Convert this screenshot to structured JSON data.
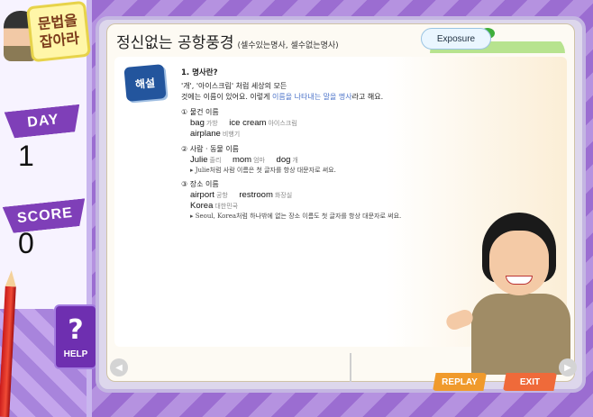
{
  "sidebar": {
    "logo_line1": "문법을",
    "logo_line2": "잡아라",
    "day_label": "DAY",
    "day_value": "1",
    "score_label": "SCORE",
    "score_value": "0",
    "help_label": "HELP"
  },
  "header": {
    "title": "정신없는 공항풍경",
    "subtitle": "(셀수있는명사, 셀수없는명사)",
    "exposure_label": "Exposure"
  },
  "lesson": {
    "badge": "해설",
    "heading": "1. 명사란?",
    "intro_a": "'개', '아이스크림' 처럼 세상의 모든",
    "intro_b": "것에는 이름이 있어요. 이렇게 ",
    "intro_highlight": "이름을 나타내는 말을 명사",
    "intro_c": "라고 해요.",
    "sections": [
      {
        "label": "① 물건 이름",
        "words": [
          {
            "en": "bag",
            "ko": "가방"
          },
          {
            "en": "ice cream",
            "ko": "아이스크림"
          },
          {
            "en": "airplane",
            "ko": "비행기"
          }
        ],
        "note": ""
      },
      {
        "label": "② 사람 · 동물 이름",
        "words": [
          {
            "en": "Julie",
            "ko": "줄리"
          },
          {
            "en": "mom",
            "ko": "엄마"
          },
          {
            "en": "dog",
            "ko": "개"
          }
        ],
        "note": "▸ Julie처럼 사람 이름은 첫 글자를 항상 대문자로 써요."
      },
      {
        "label": "③ 장소 이름",
        "words": [
          {
            "en": "airport",
            "ko": "공항"
          },
          {
            "en": "restroom",
            "ko": "화장실"
          },
          {
            "en": "Korea",
            "ko": "대한민국"
          }
        ],
        "note": "▸ Seoul, Korea처럼 하나밖에 없는 장소 이름도 첫 글자를 항상 대문자로 써요."
      }
    ]
  },
  "controls": {
    "prev_icon": "◀",
    "next_icon": "▶",
    "replay_label": "REPLAY",
    "exit_label": "EXIT"
  }
}
